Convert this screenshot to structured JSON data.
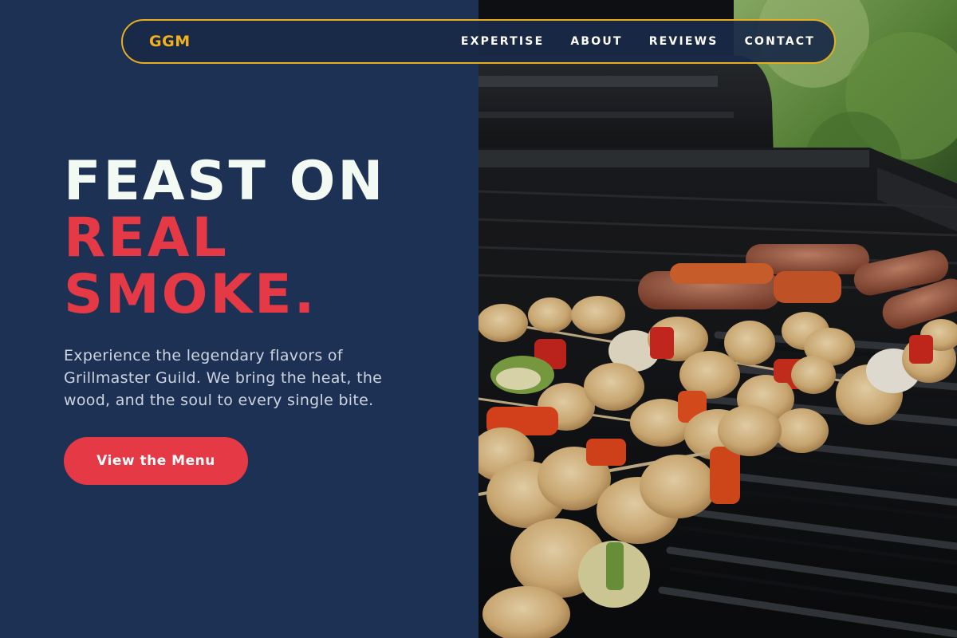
{
  "nav": {
    "logo": "GGM",
    "links": [
      "EXPERTISE",
      "ABOUT",
      "REVIEWS",
      "CONTACT"
    ]
  },
  "hero": {
    "headline_line1": "FEAST ON",
    "headline_line2": "REAL",
    "headline_line3": "SMOKE.",
    "subtitle": "Experience the legendary flavors of Grillmaster Guild. We bring the heat, the wood, and the soul to every single bite.",
    "cta_label": "View the Menu"
  },
  "colors": {
    "background": "#1d3155",
    "accent_gold": "#e9ae1f",
    "accent_red": "#e63946",
    "headline_white": "#f3faf3"
  },
  "image": {
    "subject": "barbecue-grill-with-skewers-and-sausages"
  }
}
